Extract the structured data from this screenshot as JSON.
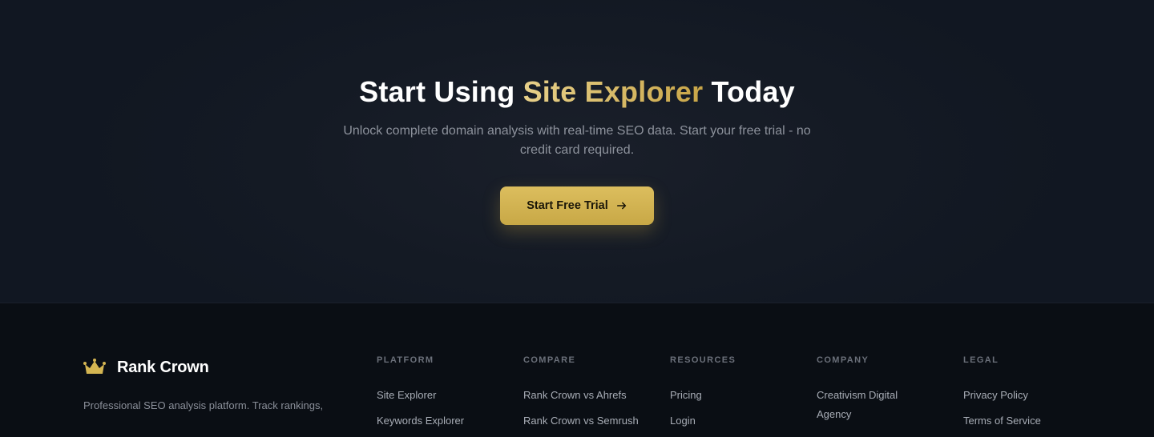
{
  "cta": {
    "title_prefix": "Start Using ",
    "title_accent": "Site Explorer",
    "title_suffix": " Today",
    "subtitle": "Unlock complete domain analysis with real-time SEO data. Start your free trial - no credit card required.",
    "button_label": "Start Free Trial",
    "button_icon": "arrow-right-icon"
  },
  "footer": {
    "brand_name": "Rank Crown",
    "brand_icon": "crown-icon",
    "description": "Professional SEO analysis platform. Track rankings,",
    "columns": [
      {
        "title": "PLATFORM",
        "links": [
          "Site Explorer",
          "Keywords Explorer"
        ]
      },
      {
        "title": "COMPARE",
        "links": [
          "Rank Crown vs Ahrefs",
          "Rank Crown vs Semrush"
        ]
      },
      {
        "title": "RESOURCES",
        "links": [
          "Pricing",
          "Login"
        ]
      },
      {
        "title": "COMPANY",
        "links": [
          "Creativism Digital Agency"
        ]
      },
      {
        "title": "LEGAL",
        "links": [
          "Privacy Policy",
          "Terms of Service"
        ]
      }
    ]
  },
  "colors": {
    "accent_gold": "#d4b552",
    "background": "#0a0e14",
    "cta_background": "#151b26"
  }
}
